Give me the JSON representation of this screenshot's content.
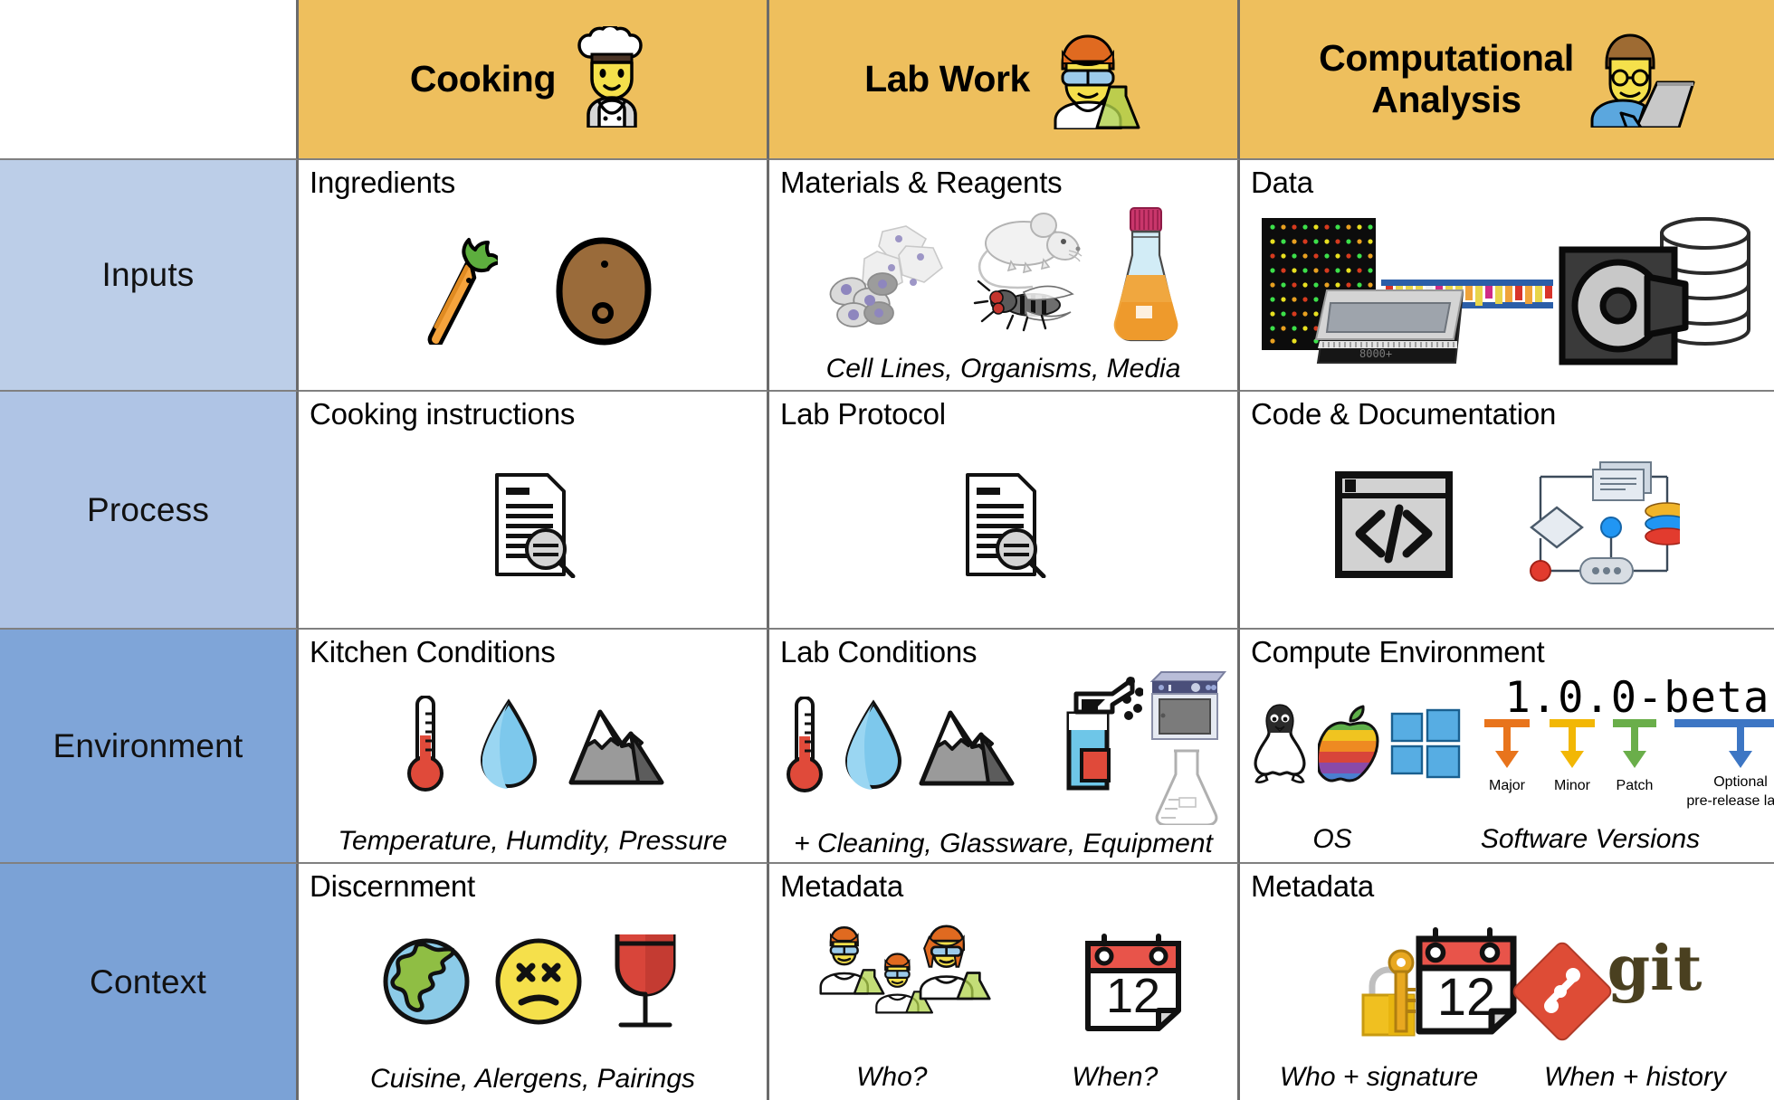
{
  "table": {
    "corner_label": "",
    "columns": [
      {
        "id": "cooking",
        "label": "Cooking",
        "icon": "chef-emoji"
      },
      {
        "id": "labwork",
        "label": "Lab Work",
        "icon": "scientist-emoji"
      },
      {
        "id": "compute",
        "label": "Computational\nAnalysis",
        "icon": "technologist-emoji"
      }
    ],
    "rows": [
      {
        "id": "inputs",
        "label": "Inputs"
      },
      {
        "id": "process",
        "label": "Process"
      },
      {
        "id": "environment",
        "label": "Environment"
      },
      {
        "id": "context",
        "label": "Context"
      }
    ],
    "cells": {
      "inputs": {
        "cooking": {
          "title": "Ingredients",
          "caption": "",
          "icons": [
            "carrot-icon",
            "potato-icon"
          ]
        },
        "labwork": {
          "title": "Materials & Reagents",
          "caption": "Cell Lines, Organisms, Media",
          "icons": [
            "cell-culture-icon",
            "mouse-icon",
            "fly-icon",
            "erlenmeyer-media-flask-icon"
          ]
        },
        "compute": {
          "title": "Data",
          "caption": "",
          "icons": [
            "microarray-icon",
            "sequencer-icon",
            "dna-gel-icon",
            "disk-drive-icon",
            "database-stack-icon"
          ]
        }
      },
      "process": {
        "cooking": {
          "title": "Cooking instructions",
          "caption": "",
          "icons": [
            "document-magnifier-icon"
          ]
        },
        "labwork": {
          "title": "Lab Protocol",
          "caption": "",
          "icons": [
            "document-magnifier-icon"
          ]
        },
        "compute": {
          "title": "Code & Documentation",
          "caption": "",
          "icons": [
            "code-window-icon",
            "workflow-diagram-icon"
          ]
        }
      },
      "environment": {
        "cooking": {
          "title": "Kitchen Conditions",
          "caption": "Temperature, Humdity, Pressure",
          "icons": [
            "thermometer-icon",
            "water-drop-icon",
            "mountain-icon"
          ]
        },
        "labwork": {
          "title": "Lab Conditions",
          "caption": "+ Cleaning, Glassware, Equipment",
          "icons": [
            "thermometer-icon",
            "water-drop-icon",
            "mountain-icon",
            "spray-bottle-icon",
            "incubator-icon",
            "erlenmeyer-flask-icon"
          ]
        },
        "compute": {
          "title": "Compute Environment",
          "caption_left": "OS",
          "caption_right": "Software Versions",
          "icons": [
            "linux-penguin-icon",
            "apple-logo-icon",
            "windows-logo-icon"
          ],
          "semver": {
            "version": "1.0.0-beta",
            "parts": [
              {
                "label": "Major",
                "color": "#E8741C"
              },
              {
                "label": "Minor",
                "color": "#F2B705"
              },
              {
                "label": "Patch",
                "color": "#6AAE4A"
              },
              {
                "label": "Optional\npre-release label",
                "color": "#3D76C4"
              }
            ]
          }
        }
      },
      "context": {
        "cooking": {
          "title": "Discernment",
          "caption": "Cuisine, Alergens, Pairings",
          "icons": [
            "globe-icon",
            "dizzy-face-icon",
            "wine-glass-icon"
          ]
        },
        "labwork": {
          "title": "Metadata",
          "caption_left": "Who?",
          "caption_right": "When?",
          "icons": [
            "scientists-group-icon",
            "calendar-icon"
          ],
          "calendar_day": "12"
        },
        "compute": {
          "title": "Metadata",
          "caption_left": "Who + signature",
          "caption_right": "When + history",
          "icons": [
            "lock-key-icon",
            "calendar-icon",
            "git-logo-icon"
          ],
          "calendar_day": "12",
          "git_wordmark": "git"
        }
      }
    }
  },
  "colors": {
    "header_bg": "#EEBF5D",
    "row_label_1": "#BCCEE8",
    "row_label_2": "#AFC4E5",
    "row_label_3": "#7FA5D8",
    "row_label_4": "#7BA2D6",
    "grid_line": "#6B6B6B"
  }
}
